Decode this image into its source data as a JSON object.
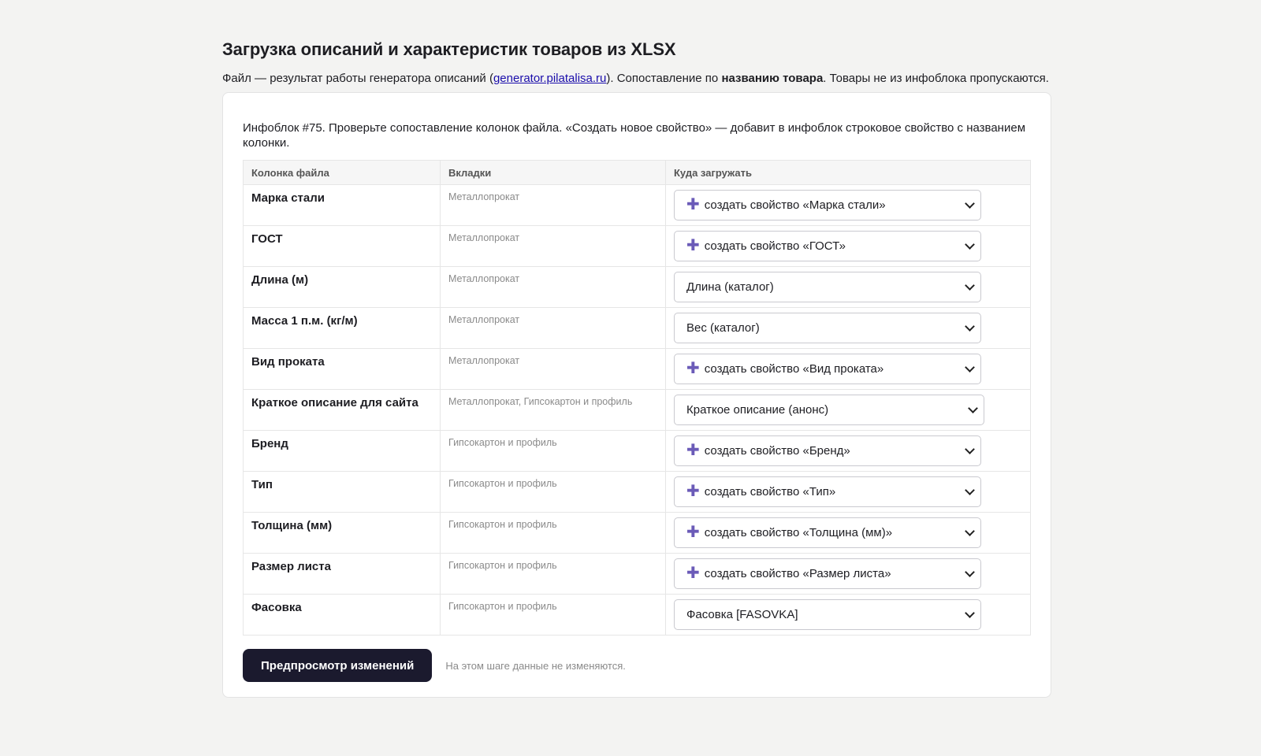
{
  "page": {
    "title": "Загрузка описаний и характеристик товаров из XLSX",
    "lead_prefix": "Файл — результат работы генератора описаний (",
    "lead_link": "generator.pilatalisa.ru",
    "lead_mid": "). Сопоставление по ",
    "lead_bold": "названию товара",
    "lead_suffix": ". Товары не из инфоблока пропускаются."
  },
  "card": {
    "info": "Инфоблок #75. Проверьте сопоставление колонок файла. «Создать новое свойство» — добавит в инфоблок строковое свойство с названием колонки."
  },
  "table": {
    "headers": [
      "Колонка файла",
      "Вкладки",
      "Куда загружать"
    ],
    "rows": [
      {
        "column": "Марка стали",
        "tabs": "Металлопрокат",
        "target": "создать свойство «Марка стали»",
        "create": true
      },
      {
        "column": "ГОСТ",
        "tabs": "Металлопрокат",
        "target": "создать свойство «ГОСТ»",
        "create": true
      },
      {
        "column": "Длина (м)",
        "tabs": "Металлопрокат",
        "target": "Длина (каталог)",
        "create": false
      },
      {
        "column": "Масса 1 п.м. (кг/м)",
        "tabs": "Металлопрокат",
        "target": "Вес (каталог)",
        "create": false
      },
      {
        "column": "Вид проката",
        "tabs": "Металлопрокат",
        "target": "создать свойство «Вид проката»",
        "create": true
      },
      {
        "column": "Краткое описание для сайта",
        "tabs": "Металлопрокат, Гипсокартон и профиль",
        "target": "Краткое описание (анонс)",
        "create": false,
        "wide": true
      },
      {
        "column": "Бренд",
        "tabs": "Гипсокартон и профиль",
        "target": "создать свойство «Бренд»",
        "create": true
      },
      {
        "column": "Тип",
        "tabs": "Гипсокартон и профиль",
        "target": "создать свойство «Тип»",
        "create": true
      },
      {
        "column": "Толщина (мм)",
        "tabs": "Гипсокартон и профиль",
        "target": "создать свойство «Толщина (мм)»",
        "create": true
      },
      {
        "column": "Размер листа",
        "tabs": "Гипсокартон и профиль",
        "target": "создать свойство «Размер листа»",
        "create": true
      },
      {
        "column": "Фасовка",
        "tabs": "Гипсокартон и профиль",
        "target": "Фасовка [FASOVKA]",
        "create": false
      }
    ]
  },
  "footer": {
    "button_label": "Предпросмотр изменений",
    "note": "На этом шаге данные не изменяются."
  },
  "icons": {
    "create_icon": "plus-icon",
    "select_icon": "chevron-down-icon"
  },
  "colors": {
    "accent": "#6b5bb8",
    "button_bg": "#1b1a2e",
    "link": "#1a0dab"
  }
}
